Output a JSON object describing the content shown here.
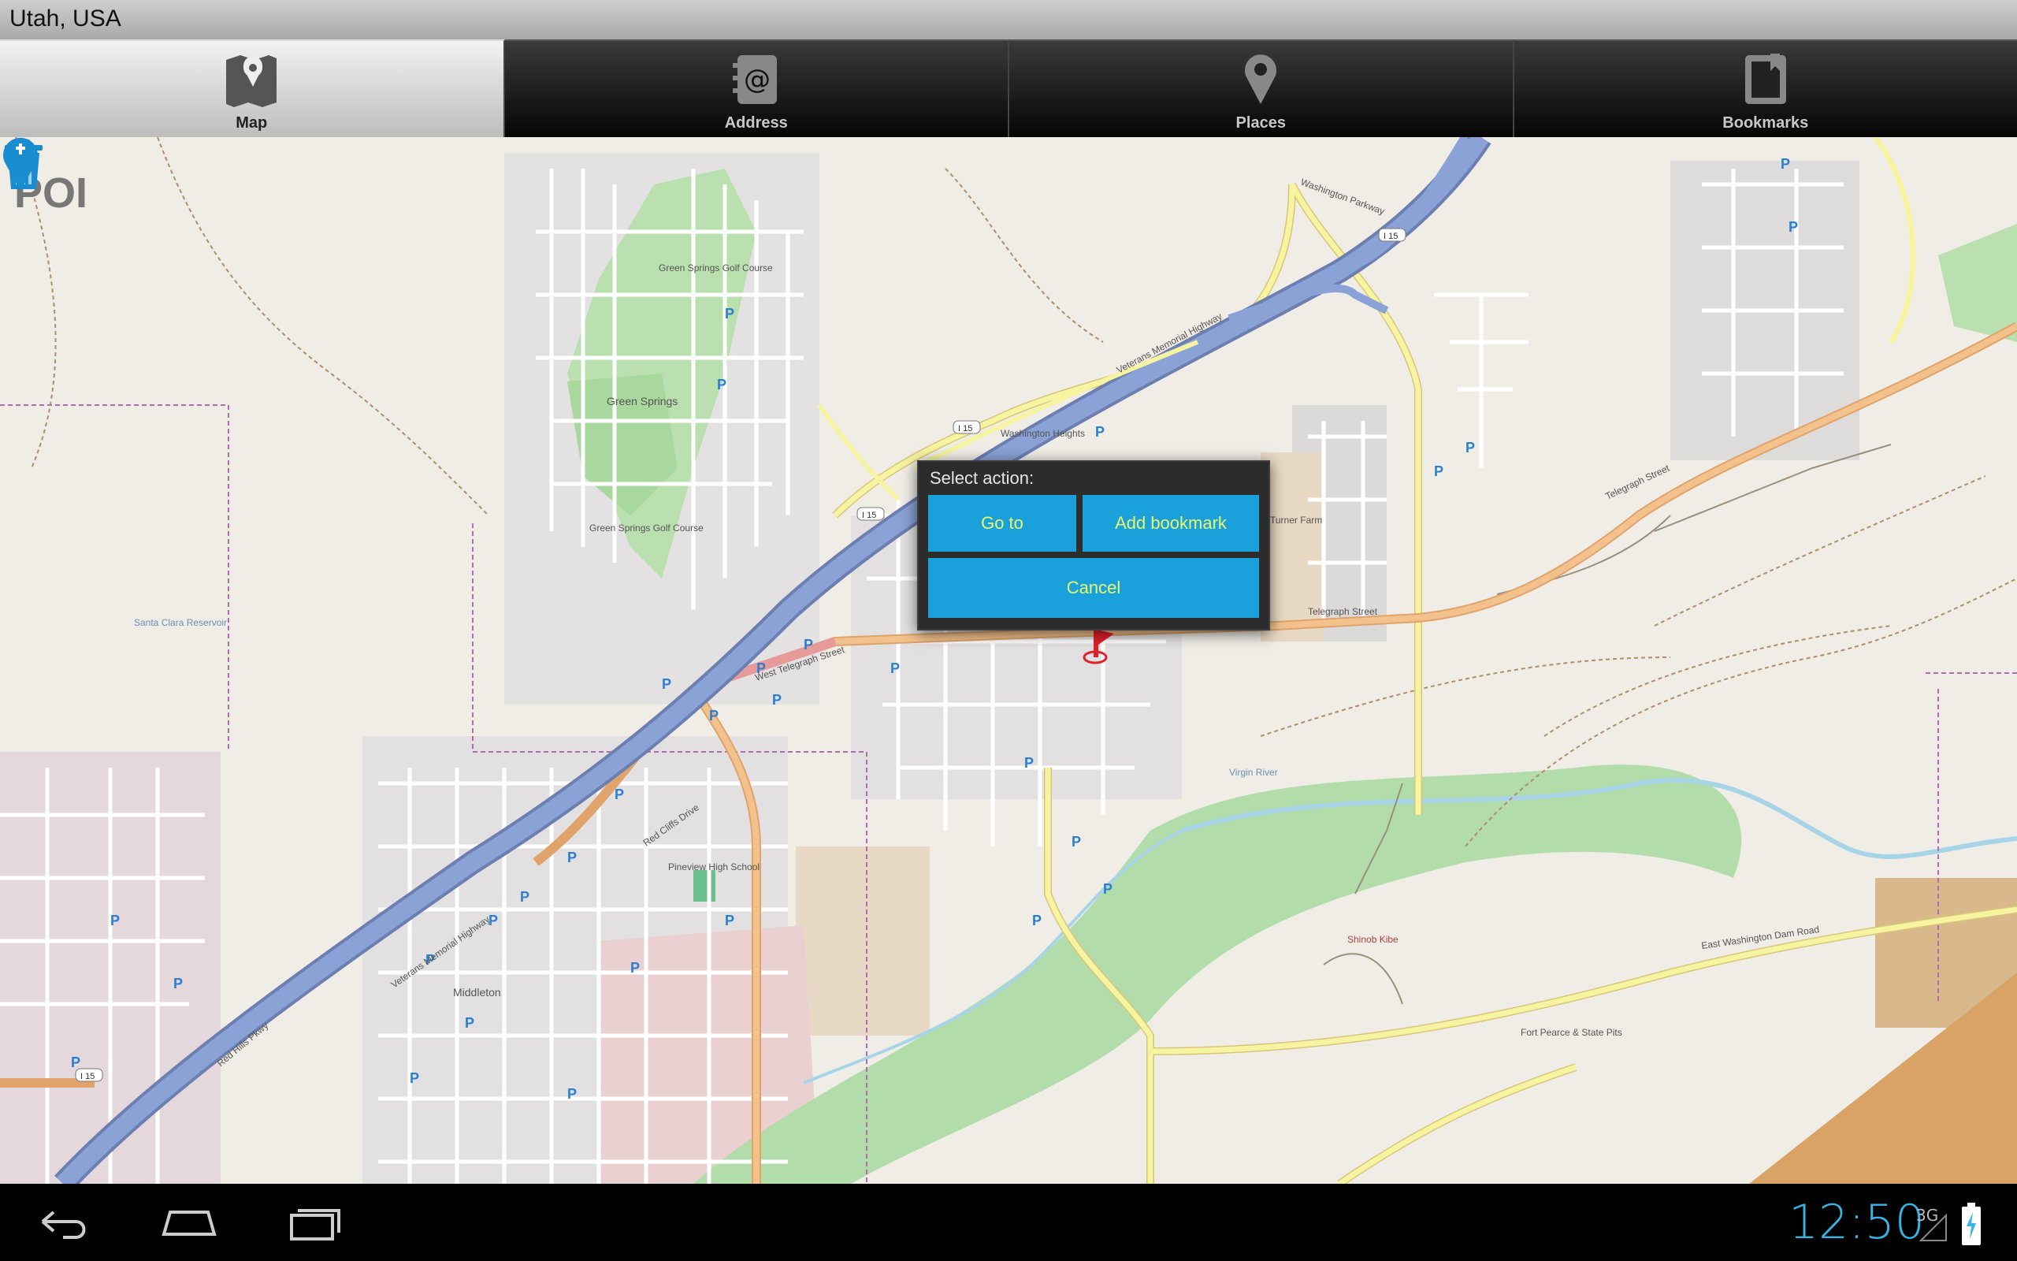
{
  "window": {
    "title": "Utah, USA"
  },
  "tabs": [
    {
      "label": "Map",
      "icon": "map-icon",
      "active": true
    },
    {
      "label": "Address",
      "icon": "address-book-icon",
      "active": false
    },
    {
      "label": "Places",
      "icon": "location-pin-icon",
      "active": false
    },
    {
      "label": "Bookmarks",
      "icon": "bookmark-icon",
      "active": false
    }
  ],
  "map": {
    "layer_label": "POI",
    "labels": {
      "green_springs": "Green Springs",
      "golf1": "Green Springs Golf Course",
      "golf2": "Green Springs Golf Course",
      "washington_heights": "Washington Heights",
      "middleton": "Middleton",
      "reservoir": "Santa Clara Reservoir",
      "virgin_river": "Virgin River",
      "telegraph": "Telegraph Street",
      "west_telegraph": "West Telegraph Street",
      "east_telegraph": "Telegraph Street",
      "washington_parkway": "Washington Parkway",
      "veterans1": "Veterans Memorial Highway",
      "veterans2": "Veterans Memorial Highway",
      "red_cliffs": "Red Cliffs Drive",
      "red_hills": "Red Hills Pkwy",
      "washington_dam": "East Washington Dam Road",
      "shinob": "Shinob Kibe",
      "turner": "Turner Farm",
      "fort_pearce": "Fort Pearce & State Pits",
      "school": "Pineview High School",
      "i15_1": "I 15",
      "i15_2": "I 15",
      "i15_3": "I 15",
      "i15_4": "I 15"
    }
  },
  "dialog": {
    "title": "Select action:",
    "buttons": {
      "goto": "Go to",
      "add_bookmark": "Add bookmark",
      "cancel": "Cancel"
    }
  },
  "status_bar": {
    "time": "12:50",
    "network": "3G"
  },
  "colors": {
    "accent": "#33b5e5",
    "dialog_button": "#1aa1dc",
    "dialog_button_text": "#e8f86a",
    "highway": "#8aa0d0",
    "primary_road": "#f3c28c",
    "secondary_road": "#f6f4a0",
    "park": "#a7dba7",
    "residential": "#e0dfdf",
    "commercial": "#ecd2d2",
    "marker": "#e3202a"
  }
}
